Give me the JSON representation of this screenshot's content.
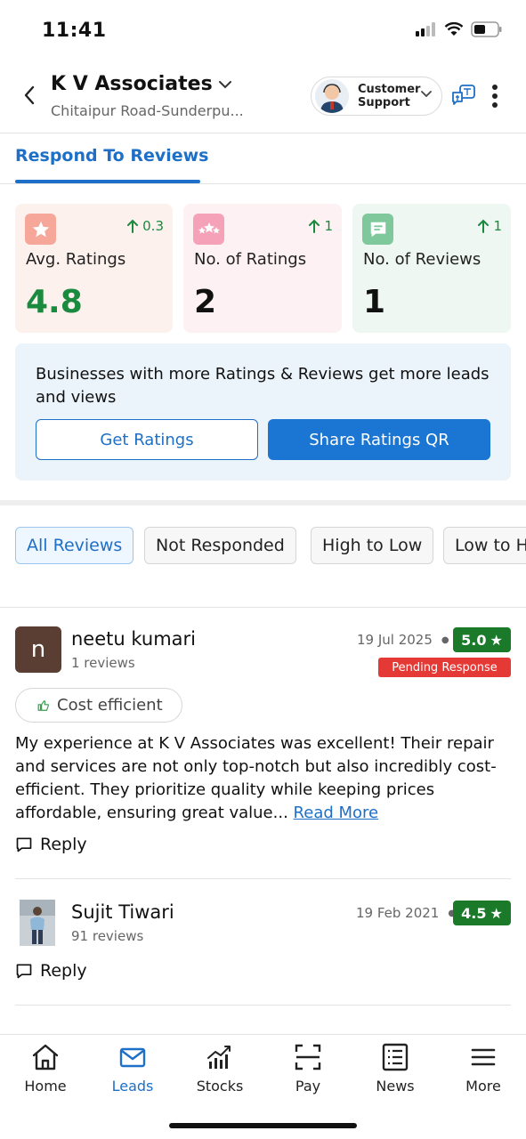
{
  "status_bar": {
    "time": "11:41"
  },
  "header": {
    "business_name": "K V Associates",
    "business_location": "Chitaipur Road-Sunderpu...",
    "support_label_line1": "Customer",
    "support_label_line2": "Support"
  },
  "tabs": {
    "active": "Respond To Reviews"
  },
  "stats": [
    {
      "label": "Avg. Ratings",
      "value": "4.8",
      "delta": "0.3",
      "value_color": "#1a8a3e",
      "bg": "#fdf1ee",
      "icon_bg": "#f6a79a"
    },
    {
      "label": "No. of Ratings",
      "value": "2",
      "delta": "1",
      "value_color": "#111111",
      "bg": "#fdf1f3",
      "icon_bg": "#f5a1b8"
    },
    {
      "label": "No. of Reviews",
      "value": "1",
      "delta": "1",
      "value_color": "#111111",
      "bg": "#eff7f2",
      "icon_bg": "#7fc89b"
    }
  ],
  "promo": {
    "text": "Businesses with more Ratings & Reviews get more leads and views",
    "get_ratings_label": "Get Ratings",
    "share_qr_label": "Share Ratings QR"
  },
  "filters": [
    "All Reviews",
    "Not Responded",
    "High to Low",
    "Low to High"
  ],
  "reviews": [
    {
      "avatar_letter": "n",
      "name": "neetu kumari",
      "count": "1 reviews",
      "date": "19 Jul 2025",
      "rating": "5.0",
      "status": "Pending Response",
      "tag": "Cost efficient",
      "text": "My experience at K V Associates was excellent! Their repair and services are not only top-notch but also incredibly cost-efficient. They prioritize quality while keeping prices affordable, ensuring great value...",
      "read_more": "Read More",
      "reply_label": "Reply"
    },
    {
      "name": "Sujit Tiwari",
      "count": "91 reviews",
      "date": "19 Feb 2021",
      "rating": "4.5",
      "reply_label": "Reply"
    }
  ],
  "bottom_nav": [
    {
      "label": "Home",
      "icon": "home-icon"
    },
    {
      "label": "Leads",
      "icon": "mail-icon",
      "active": true
    },
    {
      "label": "Stocks",
      "icon": "stocks-chart-icon"
    },
    {
      "label": "Pay",
      "icon": "scan-icon"
    },
    {
      "label": "News",
      "icon": "news-icon"
    },
    {
      "label": "More",
      "icon": "menu-icon"
    }
  ],
  "colors": {
    "accent": "#1e6fc7",
    "rating_green": "#1b7a2a",
    "pending_red": "#e53935"
  }
}
